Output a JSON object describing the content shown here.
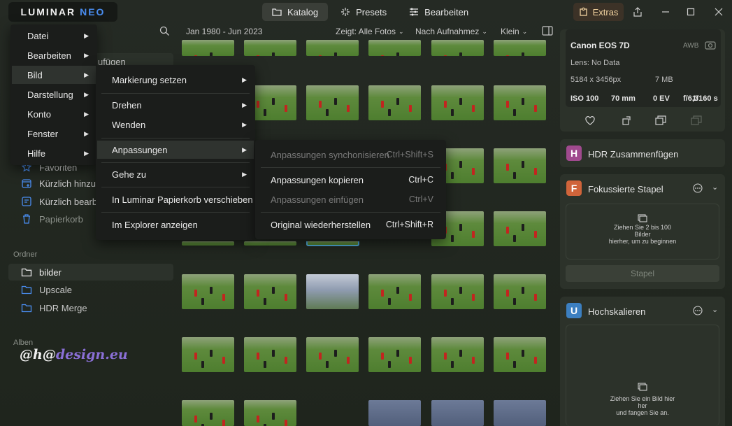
{
  "app": {
    "logo_main": "LUMINAR",
    "logo_sub": "NEO",
    "tabs": [
      "Katalog",
      "Presets",
      "Bearbeiten"
    ],
    "extras_label": "Extras"
  },
  "toolbar": {
    "date_range": "Jan 1980 - Jun 2023",
    "filter_label": "Zeigt: Alle Fotos",
    "sort_label": "Nach Aufnahmez",
    "size_label": "Klein"
  },
  "sidebar": {
    "partial_top": "ufügen",
    "items_partial": [
      "Favoriten",
      "Kürzlich hinzu",
      "Kürzlich bearb",
      "Papierkorb"
    ],
    "folders_heading": "Ordner",
    "folders": [
      "bilder",
      "Upscale",
      "HDR Merge"
    ],
    "albums_heading": "Alben",
    "watermark_a": "@h@",
    "watermark_b": "design.eu"
  },
  "main_menu": {
    "items": [
      "Datei",
      "Bearbeiten",
      "Bild",
      "Darstellung",
      "Konto",
      "Fenster",
      "Hilfe"
    ]
  },
  "bild_menu": {
    "items": [
      "Markierung setzen",
      "Drehen",
      "Wenden",
      "Anpassungen",
      "Gehe zu",
      "In Luminar Papierkorb verschieben",
      "Im Explorer anzeigen"
    ]
  },
  "anpassungen_menu": {
    "items": [
      {
        "label": "Anpassungen synchonisieren",
        "shortcut": "Ctrl+Shift+S",
        "disabled": true
      },
      {
        "label": "Anpassungen kopieren",
        "shortcut": "Ctrl+C",
        "disabled": false
      },
      {
        "label": "Anpassungen einfügen",
        "shortcut": "Ctrl+V",
        "disabled": true
      },
      {
        "label": "Original wiederherstellen",
        "shortcut": "Ctrl+Shift+R",
        "disabled": false
      }
    ]
  },
  "info_panel": {
    "camera": "Canon EOS 7D",
    "wb": "AWB",
    "lens": "Lens: No Data",
    "resolution": "5184 x 3456px",
    "filesize": "7 MB",
    "iso": "ISO 100",
    "focal": "70 mm",
    "ev": "0 EV",
    "aperture": "f/6,3",
    "shutter": "1/160 s"
  },
  "tools": {
    "hdr": {
      "badge": "H",
      "title": "HDR Zusammenfügen",
      "color": "#a04a8e"
    },
    "focus": {
      "badge": "F",
      "title": "Fokussierte Stapel",
      "color": "#d0643a",
      "drop_l1": "Ziehen Sie 2 bis 100",
      "drop_l2": "Bilder",
      "drop_l3": "hierher, um zu beginnen",
      "button": "Stapel"
    },
    "upscale": {
      "badge": "U",
      "title": "Hochskalieren",
      "color": "#3c7fc0",
      "drop_l1": "Ziehen Sie ein Bild hier",
      "drop_l2": "her",
      "drop_l3": "und fangen Sie an."
    }
  }
}
